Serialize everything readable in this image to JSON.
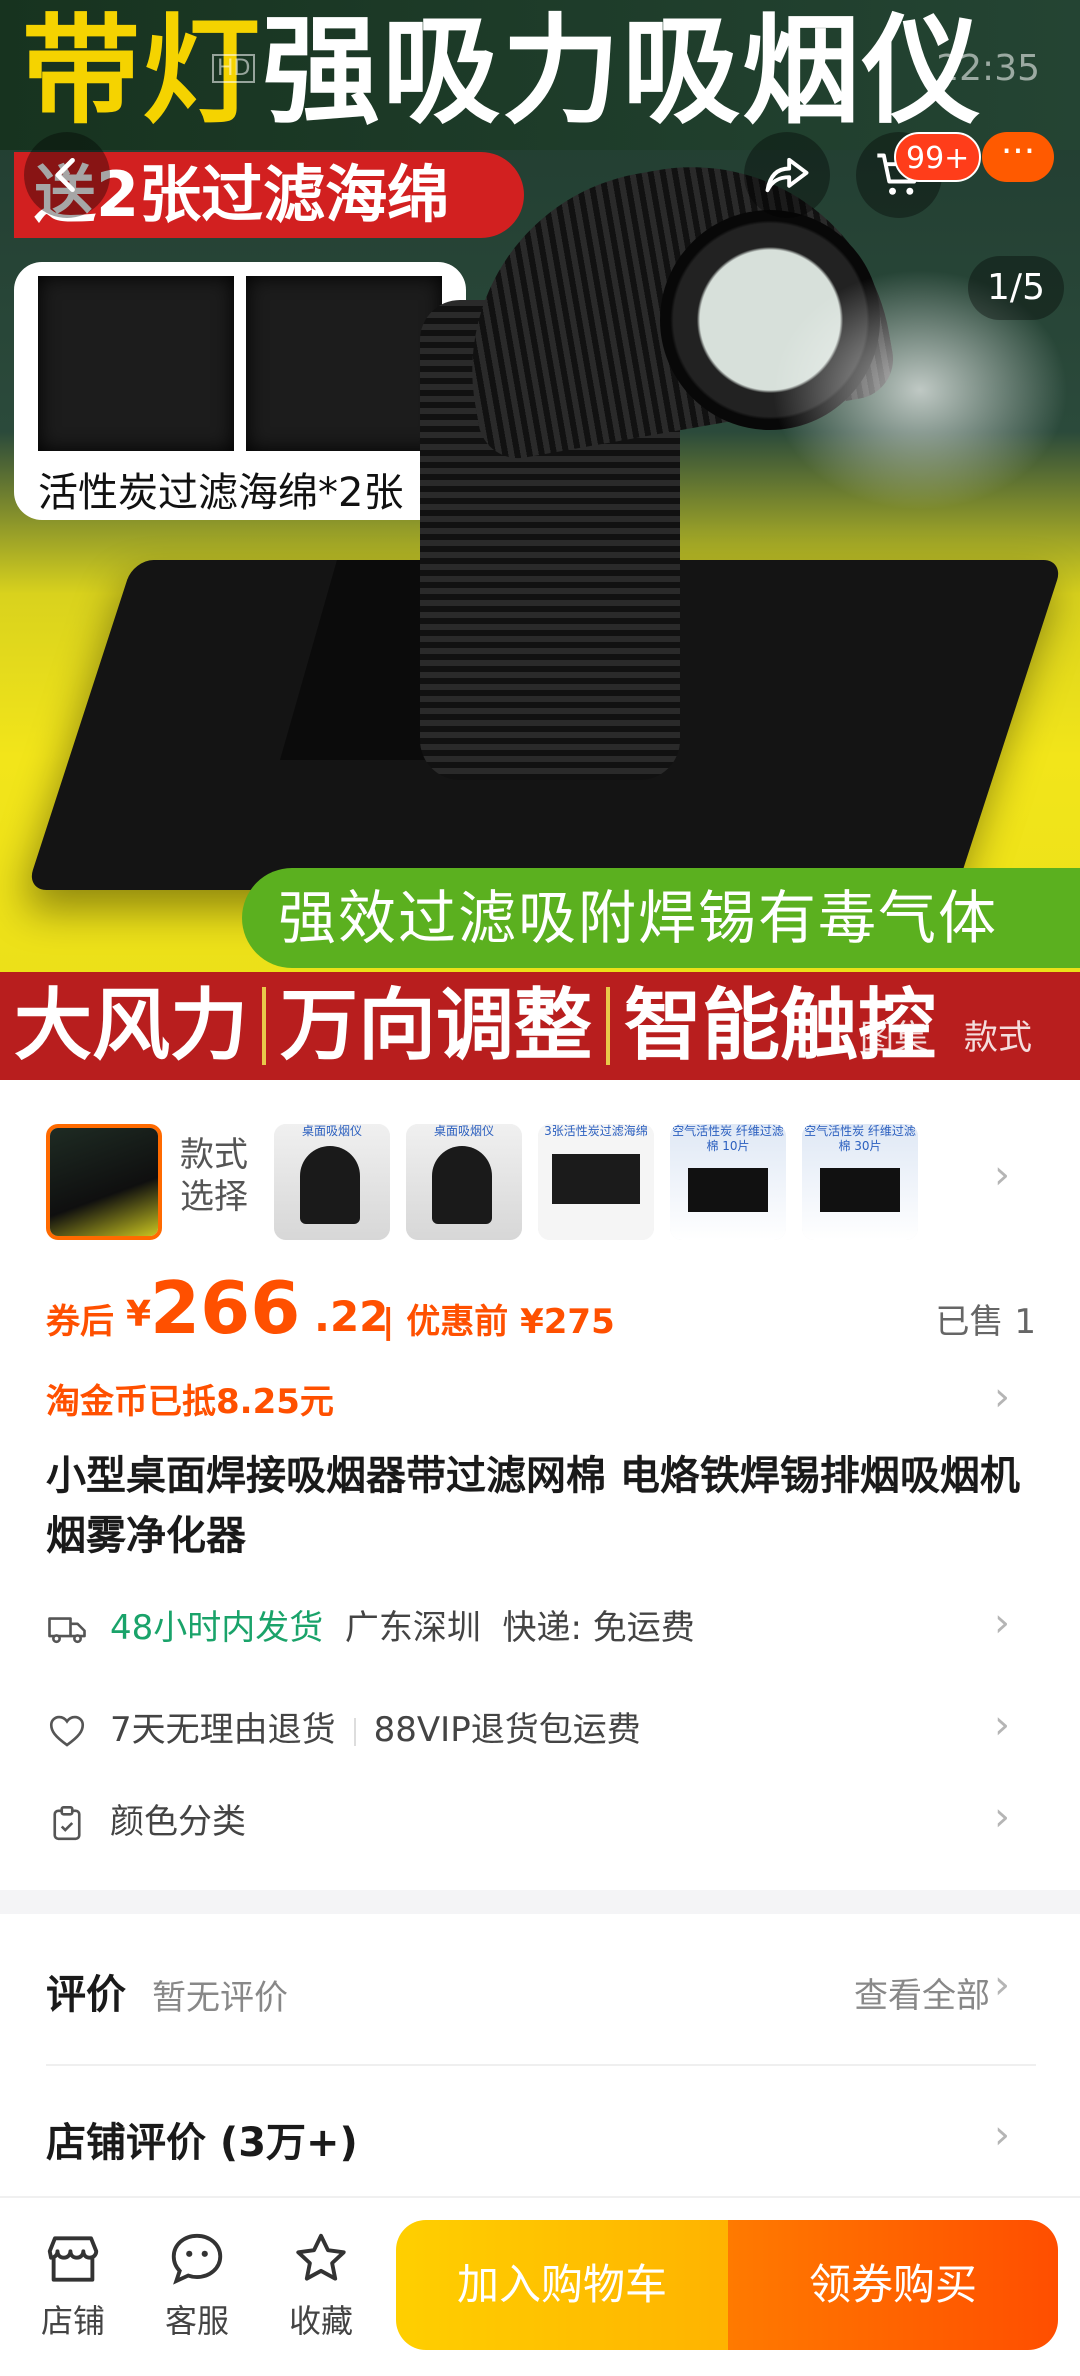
{
  "status_bar": {
    "time": "22:35",
    "hd_label": "HD"
  },
  "hero": {
    "title_highlight": "带灯",
    "title_rest": "强吸力吸烟仪",
    "gift_text": "送2张过滤海绵",
    "sponge_label": "活性炭过滤海绵*2张",
    "feature_green": "强效过滤吸附焊锡有毒气体",
    "features_red": [
      "大风力",
      "万向调整",
      "智能触控"
    ],
    "page_indicator": "1/5",
    "cart_badge": "99+",
    "more_label": "···",
    "gallery_tabs": [
      "图集",
      "款式"
    ]
  },
  "sku": {
    "label": "款式选择",
    "thumbs": [
      {
        "caption": "",
        "kind": "dark"
      },
      {
        "caption": "桌面吸烟仪",
        "kind": "photo"
      },
      {
        "caption": "桌面吸烟仪",
        "kind": "photo"
      },
      {
        "caption": "3张活性炭过滤海绵",
        "kind": "sponge"
      },
      {
        "caption": "空气活性炭 纤维过滤棉 10片",
        "kind": "pad"
      },
      {
        "caption": "空气活性炭 纤维过滤棉 30片",
        "kind": "pad"
      }
    ]
  },
  "price": {
    "coupon_label": "券后",
    "currency": "¥",
    "integer": "266",
    "decimal": ".22",
    "before_label": "| 优惠前 ¥275",
    "sold": "已售 1"
  },
  "coin_row": "淘金币已抵8.25元",
  "product_title": "小型桌面焊接吸烟器带过滤网棉 电烙铁焊锡排烟吸烟机 烟雾净化器",
  "shipping": {
    "fast": "48小时内发货",
    "origin": "广东深圳",
    "express": "快递: 免运费"
  },
  "returns": {
    "policy": "7天无理由退货",
    "vip": "88VIP退货包运费"
  },
  "color_category": "颜色分类",
  "reviews": {
    "heading": "评价",
    "sub": "暂无评价",
    "view_all": "查看全部"
  },
  "shop_reviews": "店铺评价 (3万+)",
  "bottom_bar": {
    "shop": "店铺",
    "service": "客服",
    "favorite": "收藏",
    "add_cart": "加入购物车",
    "buy": "领券购买"
  },
  "colors": {
    "accent_orange": "#ff5000",
    "ship_green": "#1aa36a",
    "cart_yellow": "#ffb300",
    "buy_orange": "#ff4e00"
  }
}
